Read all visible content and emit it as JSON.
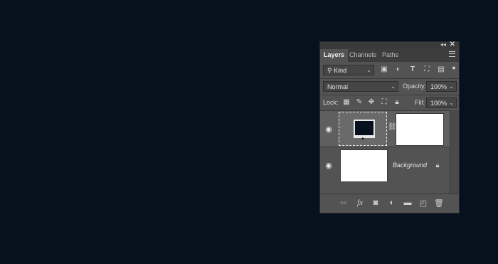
{
  "panel": {
    "tabs": [
      {
        "label": "Layers",
        "active": true
      },
      {
        "label": "Channels",
        "active": false
      },
      {
        "label": "Paths",
        "active": false
      }
    ],
    "filter": {
      "value": "Kind"
    },
    "blend_mode": {
      "value": "Normal"
    },
    "opacity": {
      "label": "Opacity:",
      "value": "100%"
    },
    "lock": {
      "label": "Lock:"
    },
    "fill": {
      "label": "Fill:",
      "value": "100%"
    },
    "layers": [
      {
        "name": "",
        "type": "smart-object",
        "has_mask": true,
        "visible": true
      },
      {
        "name": "Background",
        "locked": true,
        "visible": true
      }
    ]
  },
  "colors": {
    "accent_bg": "#07111e",
    "panel": "#535353"
  }
}
